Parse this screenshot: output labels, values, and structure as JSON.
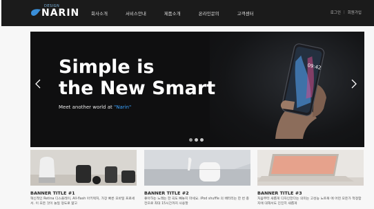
{
  "header": {
    "logo": {
      "small": "DESIGN",
      "brand": "NARIN"
    },
    "nav": [
      "회사소개",
      "서비스안내",
      "제품소개",
      "온라인문의",
      "고객센터"
    ],
    "auth": {
      "login": "로그인",
      "join": "회원가입"
    }
  },
  "hero": {
    "headline_line1": "Simple is",
    "headline_line2": "the New Smart",
    "sub_prefix": "Meet another world at ",
    "sub_brand": "\"Narin\"",
    "phone_time": "09:42",
    "slides": 3,
    "active_slide": 1
  },
  "cards": [
    {
      "title": "BANNER TITLE #1",
      "desc": "혁신적인 Retina 디스플레이, All-flash 아키텍처, 가장 빠른 모바일 프로세서. 이 모든 것이 놀일 정도로 얇고"
    },
    {
      "title": "BANNER TITLE #2",
      "desc": "좋아하는 노래는 한 곡도 빼놓지 마세요. iPod shuffle 의 배터리는 한 번 충전으로 최대 15시간까지 사용할"
    },
    {
      "title": "BANNER TITLE #3",
      "desc": "처음부터 새롭게 디자인한다는 의미는 고성능 노트북 에 어떤 모든가 적정합지에 대해서도 진진히 새롭게"
    }
  ],
  "colors": {
    "topbar": "#1b1b1b",
    "accent": "#3aa3ff",
    "hero_bg": "#0f0f10"
  }
}
